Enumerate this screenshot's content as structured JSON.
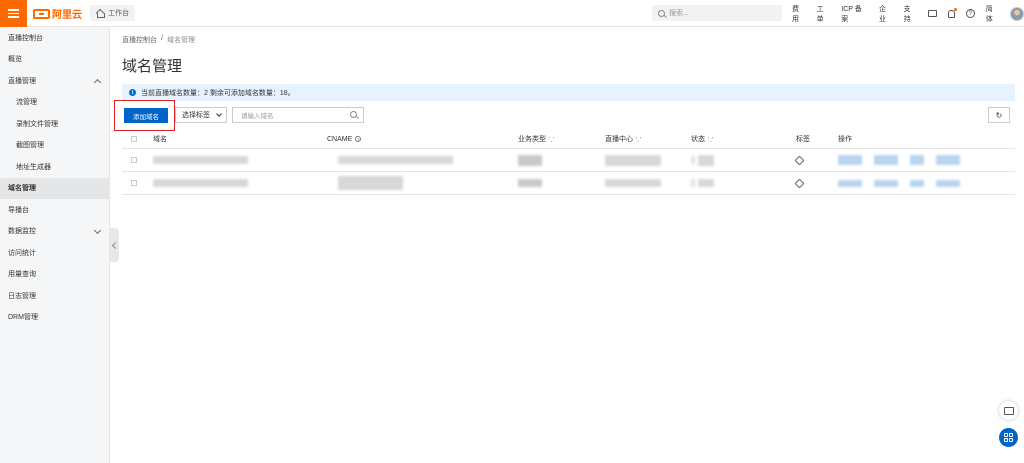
{
  "topbar": {
    "logo_text": "阿里云",
    "workbench_label": "工作台",
    "search_placeholder": "搜索...",
    "links": [
      "费用",
      "工单",
      "ICP 备案",
      "企业",
      "支持"
    ],
    "lang": "简体"
  },
  "sidebar": {
    "header": "直播控制台",
    "items": [
      {
        "label": "概览"
      },
      {
        "label": "直播管理",
        "expandable": true
      },
      {
        "label": "流管理",
        "sub": true
      },
      {
        "label": "录制文件管理",
        "sub": true
      },
      {
        "label": "截图管理",
        "sub": true
      },
      {
        "label": "地址生成器",
        "sub": true
      },
      {
        "label": "域名管理",
        "active": true
      },
      {
        "label": "导播台"
      },
      {
        "label": "数据监控",
        "expandable": true
      },
      {
        "label": "访问统计"
      },
      {
        "label": "用量查询"
      },
      {
        "label": "日志管理"
      },
      {
        "label": "DRM管理"
      }
    ]
  },
  "breadcrumb": {
    "root": "直播控制台",
    "separator": "/",
    "current": "域名管理"
  },
  "page_title": "域名管理",
  "notice": "当前直播域名数量：2 剩余可添加域名数量：18。",
  "toolbar": {
    "add_button": "添加域名",
    "tag_select": "选择标签",
    "domain_placeholder": "请输入域名",
    "refresh_icon": "refresh-icon"
  },
  "table": {
    "columns": [
      "域名",
      "CNAME",
      "业务类型",
      "直播中心",
      "状态",
      "标签",
      "操作"
    ]
  },
  "colors": {
    "brand": "#ff6a00",
    "primary": "#0064c8",
    "notice_bg": "#e6f3ff",
    "highlight_box": "#e02020"
  }
}
